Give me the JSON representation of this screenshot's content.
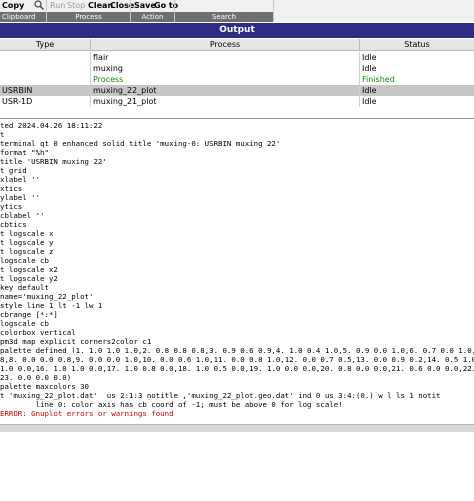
{
  "toolbar": {
    "copy": "Copy",
    "run": "Run",
    "stop": "Stop",
    "clean": "Clean",
    "close": "Close",
    "save": "Save",
    "goto": "Go to",
    "sections": [
      "Clipboard",
      "Process",
      "Action",
      "Search"
    ]
  },
  "output": {
    "title": "Output"
  },
  "table": {
    "headers": [
      "Type",
      "Process",
      "Status"
    ],
    "rows": [
      {
        "type": "",
        "process": "flair",
        "status": "Idle"
      },
      {
        "type": "",
        "process": "muxing",
        "status": "Idle"
      },
      {
        "type": "",
        "process": "Process",
        "status": "Finished"
      },
      {
        "type": "USRBIN",
        "process": "muxing_22_plot",
        "status": "Idle"
      },
      {
        "type": "USR-1D",
        "process": "muxing_21_plot",
        "status": "Idle"
      }
    ]
  },
  "console": {
    "lines": [
      "ted 2024.04.26 18:11:22",
      "t",
      "terminal qt 0 enhanced solid title 'muxing-0: USRBIN muxing 22'",
      "format \"%h\"",
      "title 'USRBIN muxing 22'",
      "t grid",
      "xlabel ''",
      "xtics",
      "ylabel ''",
      "ytics",
      "cblabel ''",
      "cbtics",
      "t logscale x",
      "t logscale y",
      "t logscale z",
      "logscale cb",
      "t logscale x2",
      "t logscale y2",
      "key default",
      "name='muxing_22_plot'",
      "style line 1 lt -1 lw 1",
      "cbrange [*:*]",
      "logscale cb",
      "colorbox vertical",
      "pm3d map explicit corners2color c1",
      "palette defined (1. 1.0 1.0 1.0,2. 0.8 0.8 0.8,3. 0.9 0.6 0.9,4. 1.0 0.4 1.0,5. 0.9 0.0 1.0,6. 0.7 0.0 1.0,7. 0.5",
      "8,8. 0.0 0.0 0.8,9. 0.0 0.0 1.0,10. 0.0 0.6 1.0,11. 0.0 0.8 1.0,12. 0.0 0.7 0.5,13. 0.0 0.9 0.2,14. 0.5 1.0 0.0,15",
      "1.0 0.0,16. 1.0 1.0 0.0,17. 1.0 0.8 0.0,18. 1.0 0.5 0.0,19. 1.0 0.0 0.0,20. 0.8 0.0 0.0,21. 0.6 0.0 0.0,22. 0.5",
      "23. 0.0 0.0 0.0)",
      "palette maxcolors 30",
      "t 'muxing_22_plot.dat'  us 2:1:3 notitle ,'muxing_22_plot.geo.dat' ind 0 us 3:4:(0.) w l ls 1 notit",
      "        line 0: color axis has cb coord of -1; must be above 0 for log scale!",
      "ERROR: Gnuplot errors or warnings found"
    ],
    "error_lines": [
      32,
      33
    ]
  },
  "colors": {
    "header_bg": "#2e2c85",
    "finished": "#138a13",
    "error": "#d00000"
  }
}
